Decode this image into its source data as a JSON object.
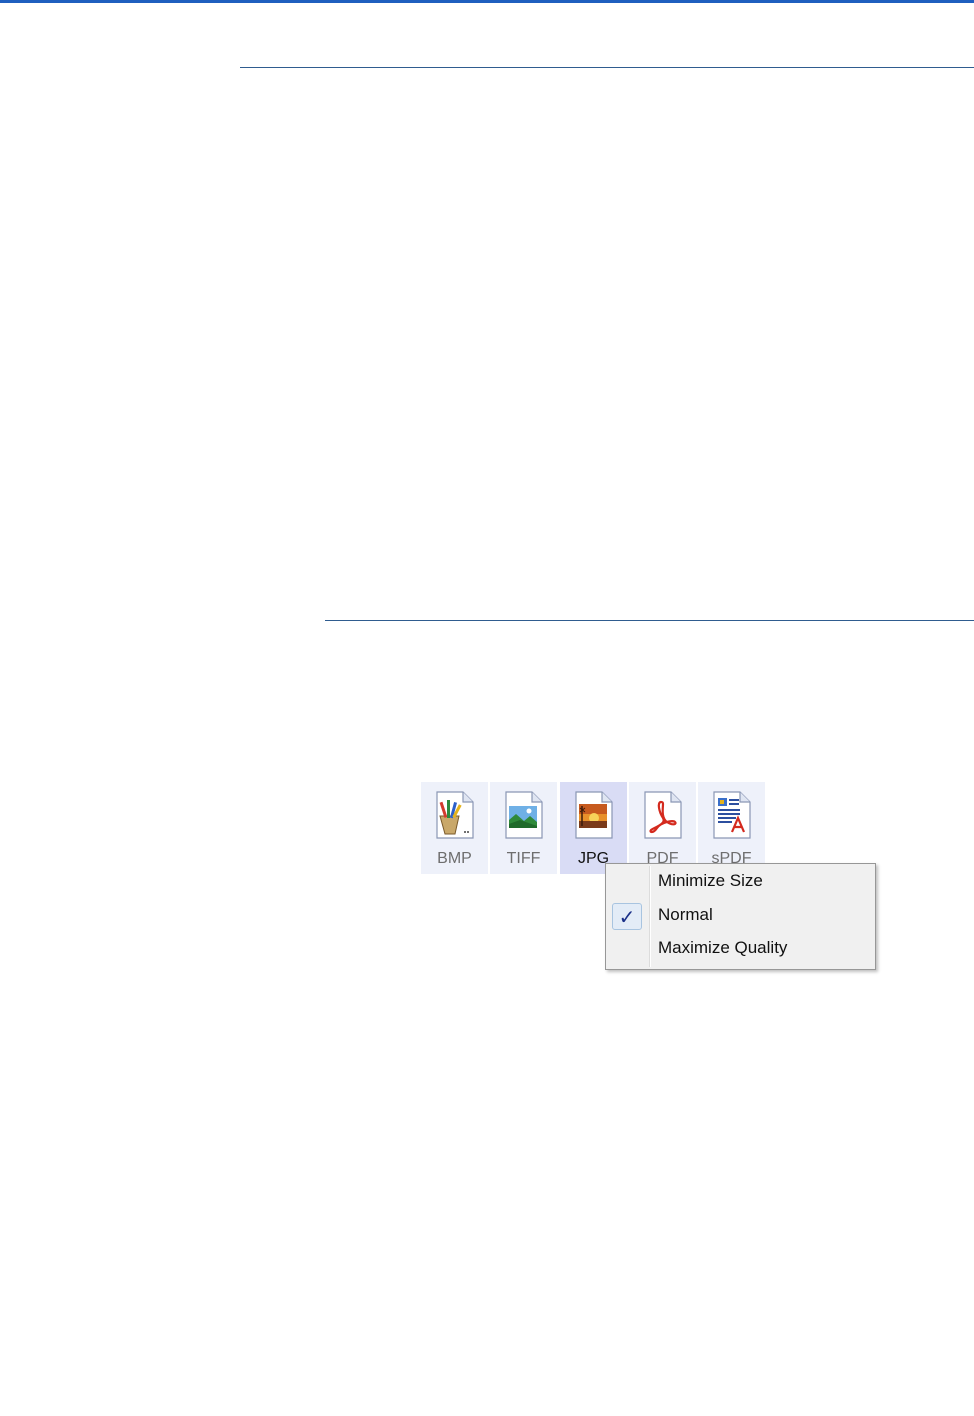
{
  "formats": [
    {
      "label": "BMP",
      "icon": "bmp-file-icon",
      "selected": false
    },
    {
      "label": "TIFF",
      "icon": "tiff-file-icon",
      "selected": false
    },
    {
      "label": "JPG",
      "icon": "jpg-file-icon",
      "selected": true
    },
    {
      "label": "PDF",
      "icon": "pdf-file-icon",
      "selected": false
    },
    {
      "label": "sPDF",
      "icon": "spdf-file-icon",
      "selected": false
    }
  ],
  "context_menu": {
    "items": [
      {
        "label": "Minimize Size",
        "checked": false
      },
      {
        "label": "Normal",
        "checked": true
      },
      {
        "label": "Maximize Quality",
        "checked": false
      }
    ],
    "check_glyph": "✓"
  },
  "colors": {
    "accent": "#1f5fbf",
    "selected_button": "#d9dcf5",
    "button": "#eef1fa",
    "menu_bg": "#f0f0f0"
  }
}
